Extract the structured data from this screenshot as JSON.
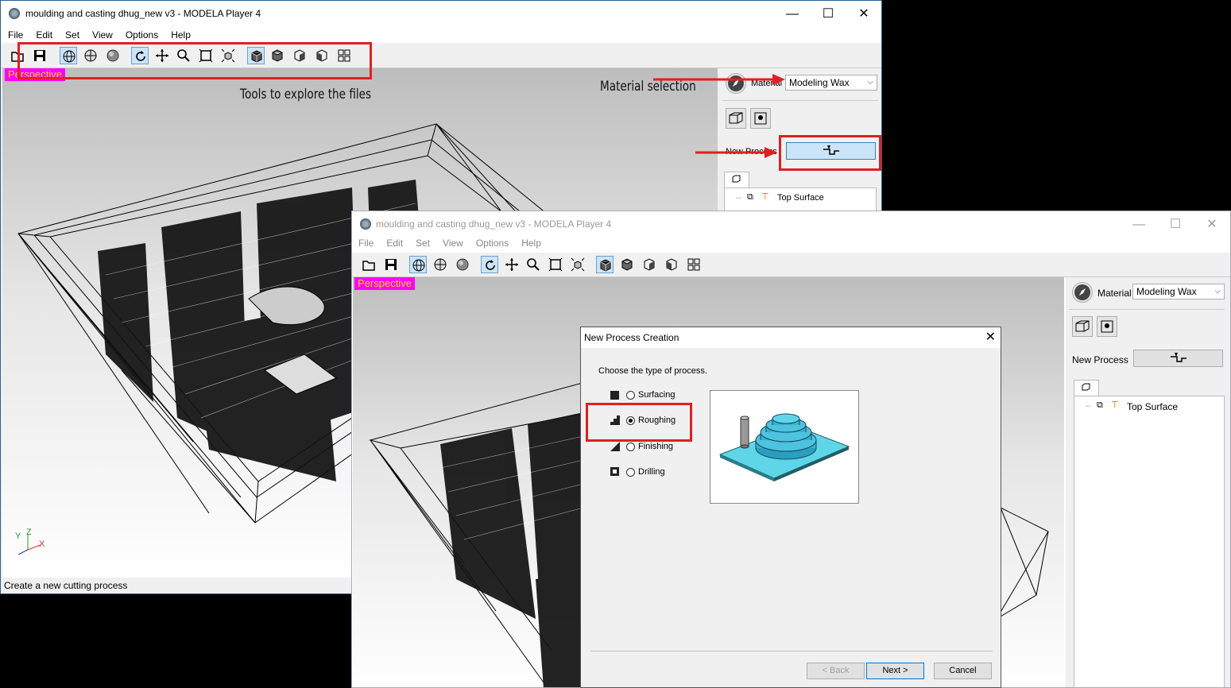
{
  "back_window": {
    "title": "moulding and casting  dhug_new v3 - MODELA Player 4",
    "controls": {
      "minimize": "—",
      "maximize": "☐",
      "close": "✕"
    },
    "menu": [
      "File",
      "Edit",
      "Set",
      "View",
      "Options",
      "Help"
    ],
    "view_label": "Perspective",
    "material_label": "Material",
    "material_value": "Modeling Wax",
    "new_process_label": "New Process",
    "tree_item": "Top Surface",
    "status_text": "Create a new cutting process",
    "axis_labels": {
      "y": "Y",
      "z": "Z",
      "x": "X"
    }
  },
  "annotations": {
    "tools": "Tools to explore the files",
    "material": "Material selection"
  },
  "front_window": {
    "title": "moulding and casting  dhug_new v3 - MODELA Player 4",
    "controls": {
      "minimize": "—",
      "maximize": "☐",
      "close": "✕"
    },
    "menu": [
      "File",
      "Edit",
      "Set",
      "View",
      "Options",
      "Help"
    ],
    "view_label": "Perspective",
    "material_label": "Material",
    "material_value": "Modeling Wax",
    "new_process_label": "New Process",
    "tree_item": "Top Surface"
  },
  "dialog": {
    "title": "New Process Creation",
    "close": "✕",
    "prompt": "Choose the type of process.",
    "options": [
      "Surfacing",
      "Roughing",
      "Finishing",
      "Drilling"
    ],
    "selected": "Roughing",
    "buttons": {
      "back": "< Back",
      "next": "Next >",
      "cancel": "Cancel"
    }
  },
  "colors": {
    "annotation_red": "#e02020",
    "perspective_bg": "#ff00ff",
    "perspective_text": "#ffde00"
  }
}
